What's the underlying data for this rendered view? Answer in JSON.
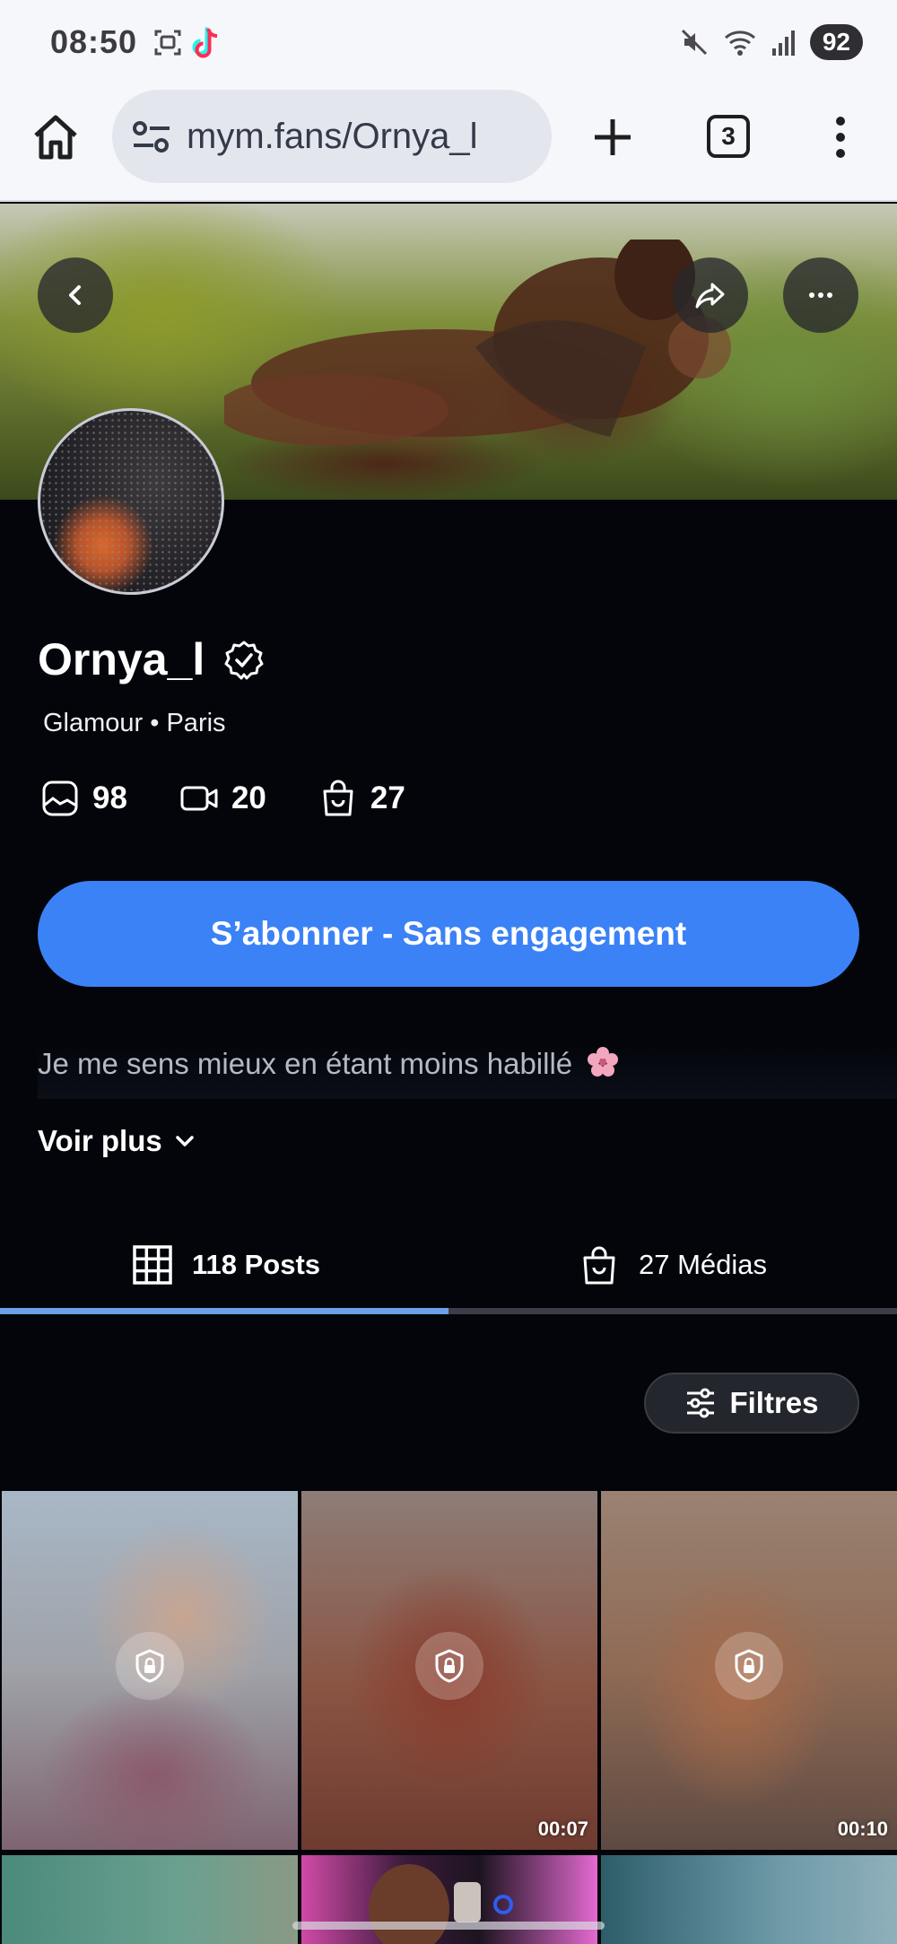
{
  "status_bar": {
    "time": "08:50",
    "battery": "92",
    "icons": [
      "screenshot-icon",
      "tiktok-icon",
      "mute-icon",
      "wifi-icon",
      "signal-icon"
    ]
  },
  "browser": {
    "url": "mym.fans/Ornya_l",
    "tab_count": "3"
  },
  "profile": {
    "username": "Ornya_l",
    "subtitle": "Glamour • Paris",
    "stats": {
      "photos": "98",
      "videos": "20",
      "medias": "27"
    },
    "subscribe_label": "S’abonner - Sans engagement",
    "bio": "Je me sens mieux en étant moins habillé",
    "see_more_label": "Voir plus"
  },
  "tabs": {
    "posts_label": "118 Posts",
    "medias_label": "27 Médias",
    "active": "posts",
    "progress": 0.5
  },
  "filters_label": "Filtres",
  "grid": [
    {
      "duration": "",
      "locked": true
    },
    {
      "duration": "00:07",
      "locked": true
    },
    {
      "duration": "00:10",
      "locked": true
    }
  ],
  "colors": {
    "accent": "#3b82f6",
    "background": "#03050b",
    "tab_indicator": "#6c9fe8"
  }
}
